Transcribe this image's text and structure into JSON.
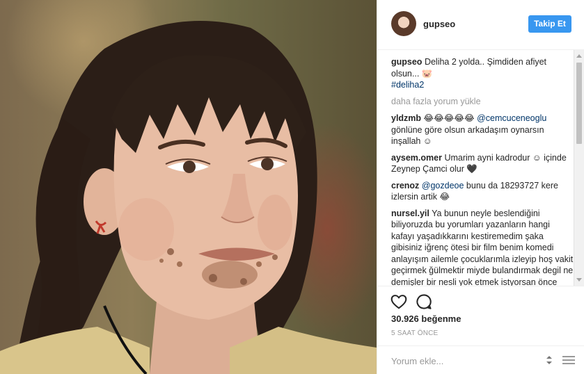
{
  "post": {
    "username": "gupseo",
    "follow_label": "Takip Et",
    "likes": "30.926 beğenme",
    "time": "5 SAAT ÖNCE",
    "comment_placeholder": "Yorum ekle..."
  },
  "caption": {
    "username": "gupseo",
    "text": "Deliha 2 yolda.. Şimdiden afiyet olsun... 🐷",
    "hashtag": "#deliha2"
  },
  "load_more_label": "daha fazla yorum yükle",
  "comments": [
    {
      "username": "yldzmb",
      "emojis": "😂😂😂😂😂",
      "mention": "@cemcuceneoglu",
      "text": "gönlüne göre olsun arkadaşım oynarsın inşallah ☺"
    },
    {
      "username": "aysem.omer",
      "text": "Umarim ayni kadrodur ☺ içinde Zeynep Çamci olur 🖤"
    },
    {
      "username": "crenoz",
      "mention": "@gozdeoe",
      "text": "bunu da 18293727 kere izlersin artik 😂"
    },
    {
      "username": "nursel.yil",
      "text": "Ya bunun neyle beslendiğini biliyoruzda bu yorumları yazanların hangi kafayı yaşadıkkarını kestiremedim şaka gibisiniz iğrenç ötesi bir film benim komedi anlayışım ailemle çocuklarımla izleyip hoş vakit geçirmek ğülmektir miyde bulandırmak degil ne demişler bir nesli yok etmek istyorsan önce dilini boz aynen öyle"
    }
  ],
  "icons": {
    "avatar": "profile-avatar",
    "like": "heart-icon",
    "comment": "comment-bubble-icon",
    "options": "more-options-icon"
  },
  "colors": {
    "accent": "#3897f0",
    "tag": "#003569",
    "muted": "#999999",
    "text": "#262626"
  }
}
